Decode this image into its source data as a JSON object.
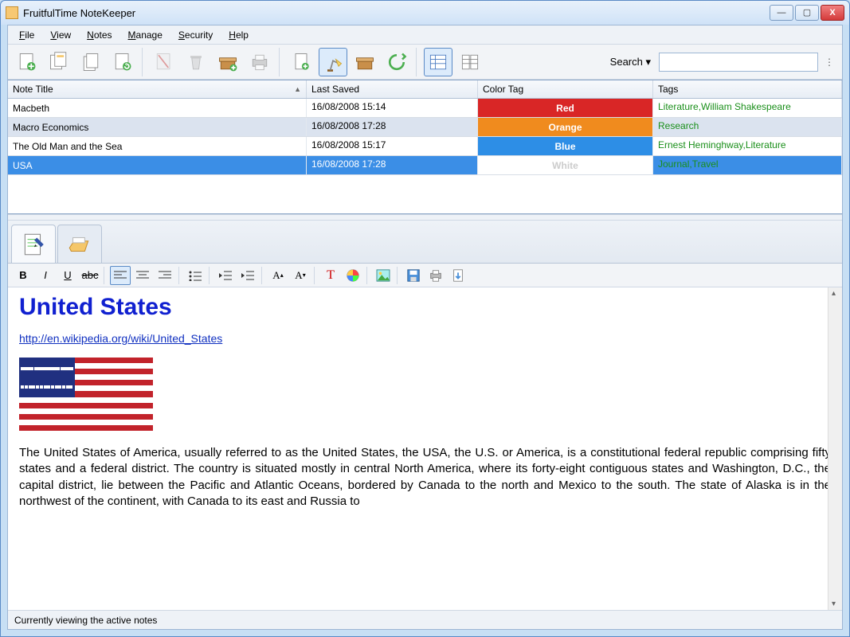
{
  "title": "FruitfulTime NoteKeeper",
  "menu": {
    "file": "File",
    "view": "View",
    "notes": "Notes",
    "manage": "Manage",
    "security": "Security",
    "help": "Help"
  },
  "search_label": "Search ▾",
  "columns": {
    "title": "Note Title",
    "saved": "Last Saved",
    "color": "Color Tag",
    "tags": "Tags"
  },
  "rows": [
    {
      "title": "Macbeth",
      "saved": "16/08/2008 15:14",
      "color": "Red",
      "tags": "Literature,William Shakespeare",
      "alt": false,
      "sel": false
    },
    {
      "title": "Macro Economics",
      "saved": "16/08/2008 17:28",
      "color": "Orange",
      "tags": "Research",
      "alt": true,
      "sel": false
    },
    {
      "title": "The Old Man and the Sea",
      "saved": "16/08/2008 15:17",
      "color": "Blue",
      "tags": "Ernest Heminghway,Literature",
      "alt": false,
      "sel": false
    },
    {
      "title": "USA",
      "saved": "16/08/2008 17:28",
      "color": "White",
      "tags": "Journal,Travel",
      "alt": false,
      "sel": true
    }
  ],
  "note": {
    "heading": "United States",
    "url": "http://en.wikipedia.org/wiki/United_States",
    "body": "The United States of America, usually referred to as the United States, the USA, the U.S. or America, is a constitutional federal republic comprising fifty states and a federal district. The country is situated mostly in central North America, where its forty-eight contiguous states and Washington, D.C., the capital district, lie between the Pacific and Atlantic Oceans, bordered by Canada to the north and Mexico to the south. The state of Alaska is in the northwest of the continent, with Canada to its east and Russia to"
  },
  "status": "Currently viewing the active notes"
}
